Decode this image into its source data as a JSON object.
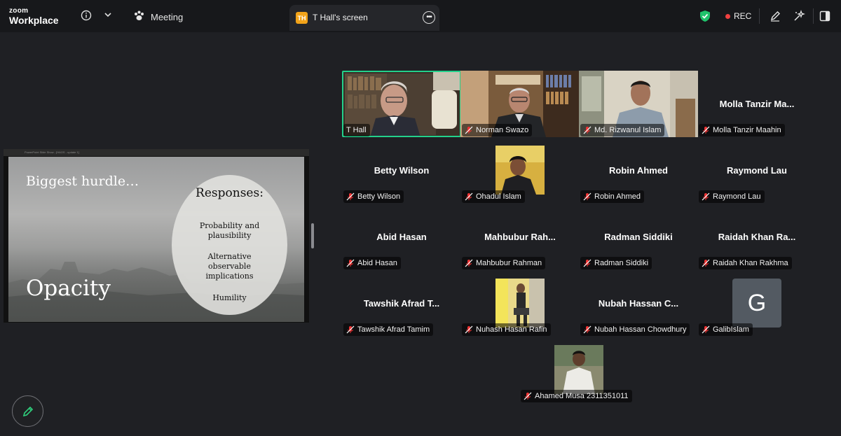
{
  "app": {
    "logo_line1": "zoom",
    "logo_line2": "Workplace"
  },
  "topbar": {
    "meeting_label": "Meeting",
    "screen_tab_badge": "TH",
    "screen_tab_label": "T Hall's screen",
    "rec_label": "REC"
  },
  "slide": {
    "window_caption": "PowerPoint Slide Show - [HAOS - update 1]",
    "title": "Biggest hurdle…",
    "big_word": "Opacity",
    "responses_heading": "Responses:",
    "responses": [
      "Probability and plausibility",
      "Alternative observable implications",
      "Humility"
    ]
  },
  "participants": [
    {
      "name": "T Hall",
      "display": "",
      "kind": "video",
      "active": true
    },
    {
      "name": "Norman Swazo",
      "display": "",
      "kind": "video"
    },
    {
      "name": "Md. Rizwanul Islam",
      "display": "",
      "kind": "video"
    },
    {
      "name": "Molla Tanzir Maahin",
      "display": "Molla  Tanzir  Ma...",
      "kind": "name"
    },
    {
      "name": "Betty Wilson",
      "display": "Betty Wilson",
      "kind": "name"
    },
    {
      "name": "Ohadul Islam",
      "display": "",
      "kind": "photo"
    },
    {
      "name": "Robin Ahmed",
      "display": "Robin Ahmed",
      "kind": "name"
    },
    {
      "name": "Raymond Lau",
      "display": "Raymond Lau",
      "kind": "name"
    },
    {
      "name": "Abid Hasan",
      "display": "Abid Hasan",
      "kind": "name"
    },
    {
      "name": "Mahbubur Rahman",
      "display": "Mahbubur  Rah...",
      "kind": "name"
    },
    {
      "name": "Radman Siddiki",
      "display": "Radman Siddiki",
      "kind": "name"
    },
    {
      "name": "Raidah Khan Rakhma",
      "display": "Raidah  Khan  Ra...",
      "kind": "name"
    },
    {
      "name": "Tawshik Afrad Tamim",
      "display": "Tawshik Afrad T...",
      "kind": "name"
    },
    {
      "name": "Nuhash Hasan Rafin",
      "display": "",
      "kind": "photo"
    },
    {
      "name": "Nubah Hassan Chowdhury",
      "display": "Nubah  Hassan  C...",
      "kind": "name"
    },
    {
      "name": "GalibIslam",
      "display": "G",
      "kind": "avatar"
    },
    {
      "name": "Ahamed Musa 2311351011",
      "display": "",
      "kind": "photo"
    }
  ],
  "colors": {
    "active_speaker": "#23d18b",
    "rec_dot": "#f04040",
    "shield": "#1fc36b",
    "avatar_bg": "#535a62",
    "badge": "#f2a319"
  }
}
